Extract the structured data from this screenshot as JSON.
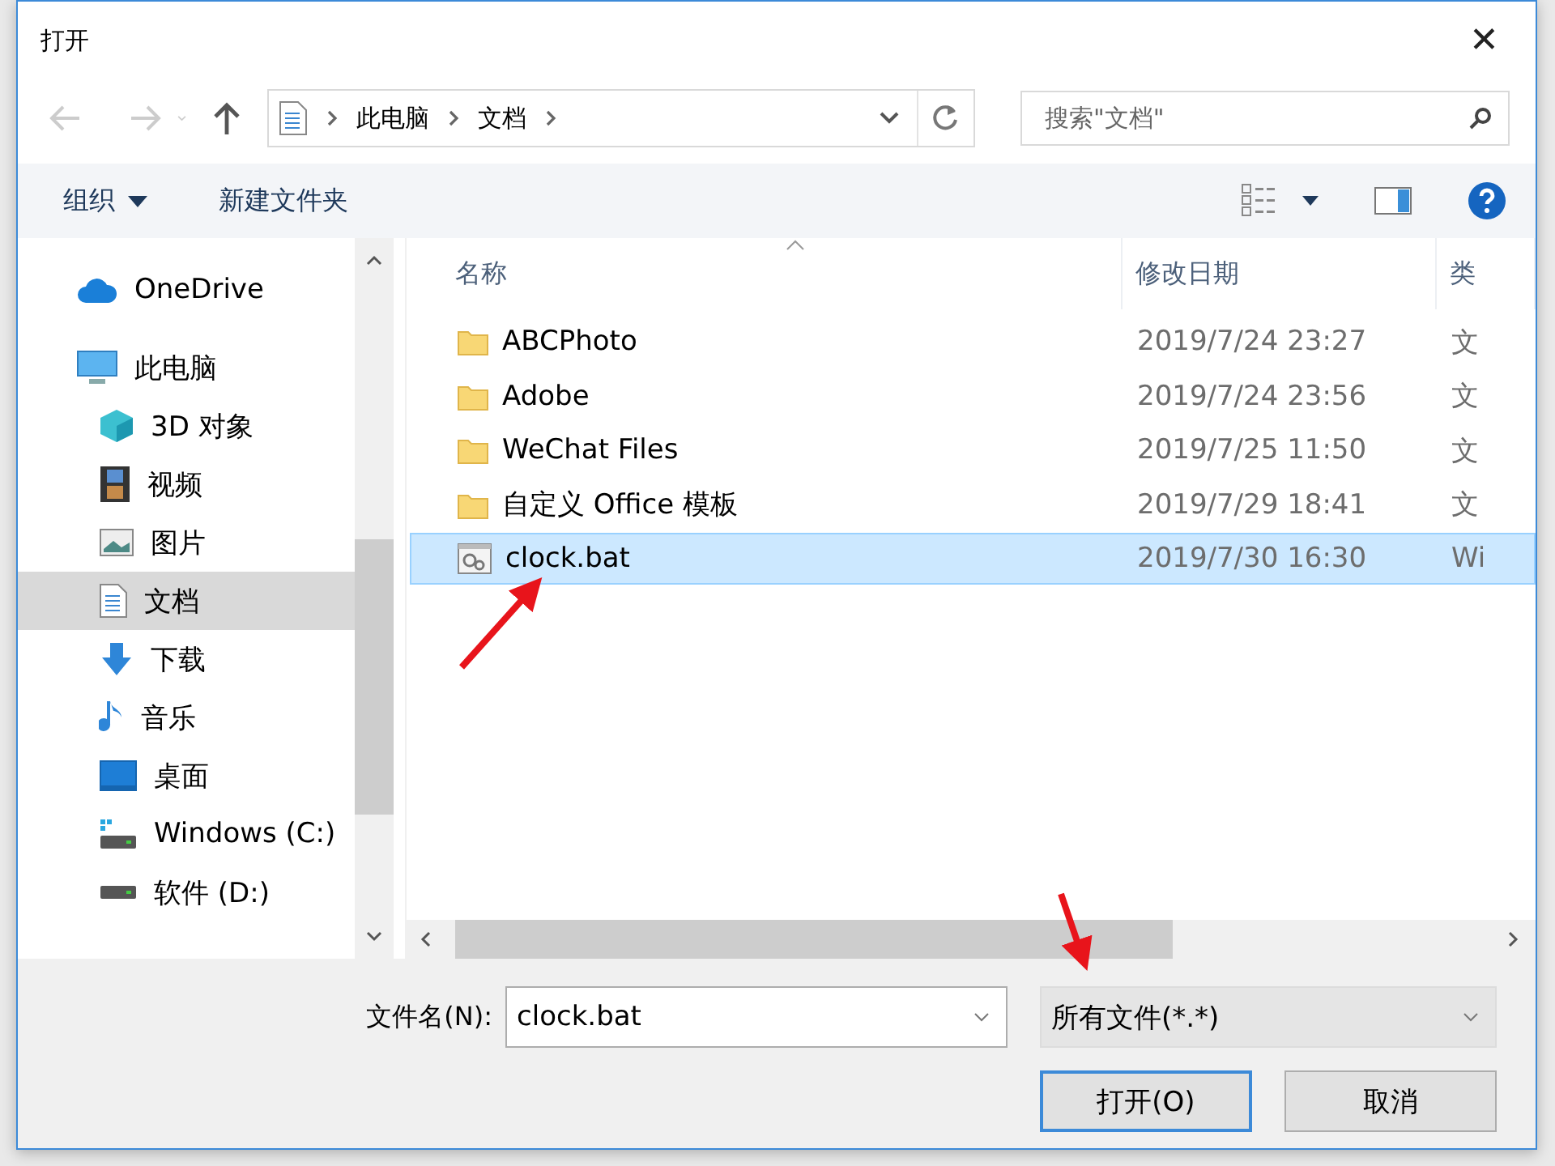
{
  "window": {
    "title": "打开",
    "close": "✕"
  },
  "breadcrumb": [
    "此电脑",
    "文档"
  ],
  "search": {
    "placeholder": "搜索\"文档\""
  },
  "toolbar": [
    {
      "label": "组织",
      "dropdown": true
    },
    {
      "label": "新建文件夹",
      "dropdown": false
    }
  ],
  "sidebar": {
    "items": [
      {
        "label": "OneDrive",
        "selected": false
      },
      {
        "label": "此电脑",
        "selected": false,
        "children": [
          {
            "label": "3D 对象",
            "selected": false
          },
          {
            "label": "视频",
            "selected": false
          },
          {
            "label": "图片",
            "selected": false
          },
          {
            "label": "文档",
            "selected": true
          },
          {
            "label": "下载",
            "selected": false
          },
          {
            "label": "音乐",
            "selected": false
          },
          {
            "label": "桌面",
            "selected": false
          },
          {
            "label": "Windows (C:)",
            "selected": false
          },
          {
            "label": "软件 (D:)",
            "selected": false
          }
        ]
      }
    ]
  },
  "table": {
    "columns": [
      "名称",
      "修改日期",
      "类"
    ],
    "rows": [
      {
        "kind": "folder",
        "name": "ABCPhoto",
        "date": "2019/7/24 23:27",
        "type": "文",
        "selected": false
      },
      {
        "kind": "folder",
        "name": "Adobe",
        "date": "2019/7/24 23:56",
        "type": "文",
        "selected": false
      },
      {
        "kind": "folder",
        "name": "WeChat Files",
        "date": "2019/7/25 11:50",
        "type": "文",
        "selected": false
      },
      {
        "kind": "folder",
        "name": "自定义 Office 模板",
        "date": "2019/7/29 18:41",
        "type": "文",
        "selected": false
      },
      {
        "kind": "file",
        "name": "clock.bat",
        "date": "2019/7/30 16:30",
        "type": "Wi",
        "selected": true
      }
    ]
  },
  "filename": {
    "label": "文件名(N):",
    "value": "clock.bat"
  },
  "filter": {
    "value": "所有文件(*.*)"
  },
  "buttons": [
    {
      "label": "打开(O)",
      "default": true
    },
    {
      "label": "取消",
      "default": false
    }
  ]
}
